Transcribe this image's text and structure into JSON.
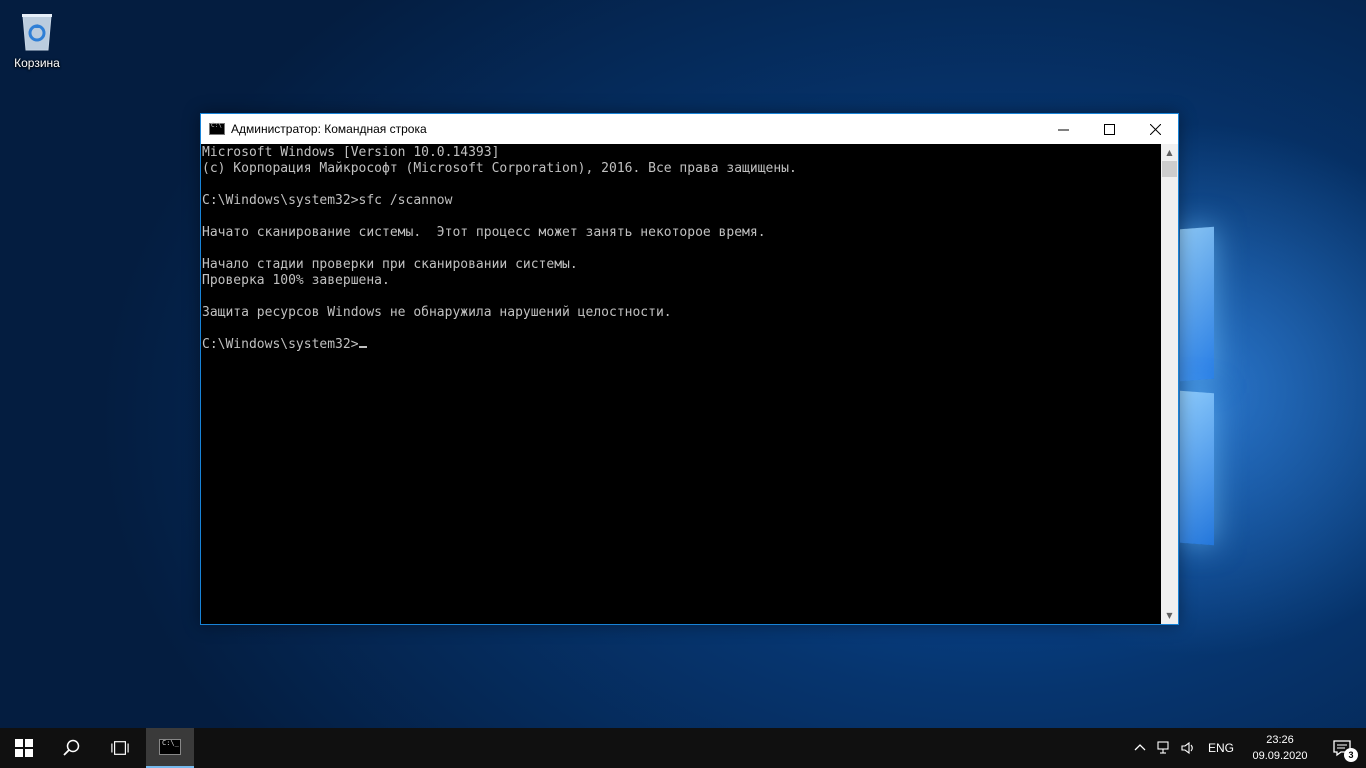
{
  "desktop": {
    "icons": [
      {
        "label": "Корзина",
        "icon": "recycle-bin-icon"
      }
    ]
  },
  "window": {
    "title": "Администратор: Командная строка",
    "icon": "cmd-icon",
    "controls": {
      "minimize": "minimize-icon",
      "maximize": "maximize-icon",
      "close": "close-icon"
    },
    "console_lines": [
      "Microsoft Windows [Version 10.0.14393]",
      "(c) Корпорация Майкрософт (Microsoft Corporation), 2016. Все права защищены.",
      "",
      "C:\\Windows\\system32>sfc /scannow",
      "",
      "Начато сканирование системы.  Этот процесс может занять некоторое время.",
      "",
      "Начало стадии проверки при сканировании системы.",
      "Проверка 100% завершена.",
      "",
      "Защита ресурсов Windows не обнаружила нарушений целостности.",
      ""
    ],
    "prompt": "C:\\Windows\\system32>"
  },
  "taskbar": {
    "start": "windows-start-icon",
    "search": "search-icon",
    "task_view": "task-view-icon",
    "apps": [
      {
        "name": "cmd",
        "icon": "cmd-icon",
        "active": true
      }
    ],
    "tray": {
      "chevron": "chevron-up-icon",
      "network": "network-icon",
      "volume": "volume-icon",
      "language": "ENG",
      "time": "23:26",
      "date": "09.09.2020",
      "notification_count": "3"
    }
  },
  "colors": {
    "console_bg": "#000000",
    "console_fg": "#c0c0c0",
    "window_border": "#1883d7",
    "taskbar_bg": "#101010",
    "taskbar_active_accent": "#76b9ed"
  }
}
